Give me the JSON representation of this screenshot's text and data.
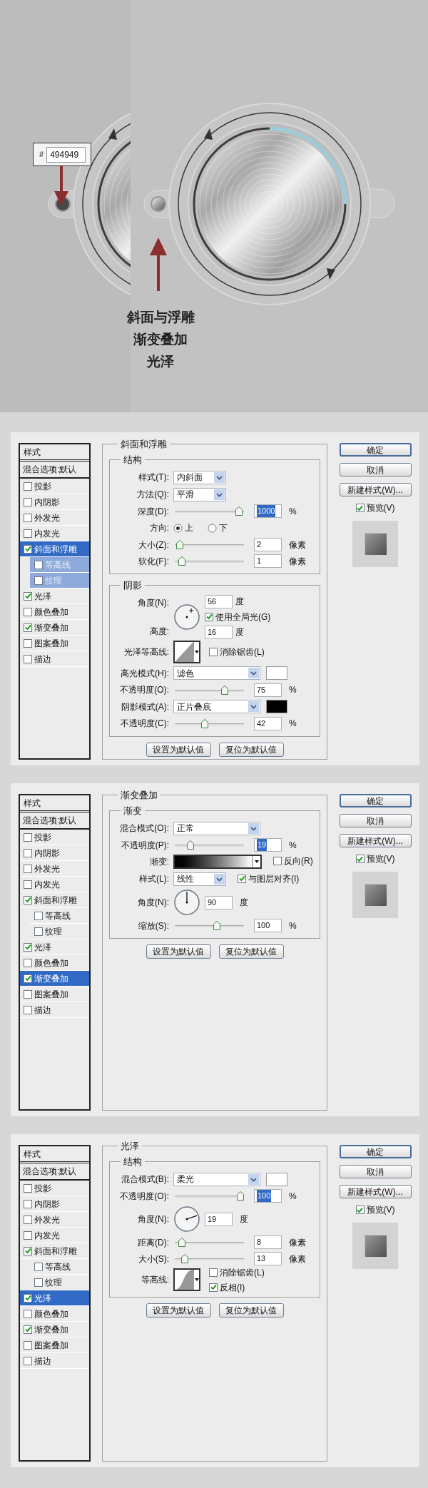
{
  "artwork": {
    "color_label": {
      "hash": "#",
      "value": "494949"
    },
    "captions": [
      "斜面与浮雕",
      "渐变叠加",
      "光泽"
    ]
  },
  "dialogs": [
    {
      "styles_header": "样式",
      "blend_options": "混合选项:默认",
      "styles": [
        {
          "label": "投影",
          "checked": false,
          "selected": false
        },
        {
          "label": "内阴影",
          "checked": false,
          "selected": false
        },
        {
          "label": "外发光",
          "checked": false,
          "selected": false
        },
        {
          "label": "内发光",
          "checked": false,
          "selected": false
        },
        {
          "label": "斜面和浮雕",
          "checked": true,
          "selected": true,
          "children": [
            {
              "label": "等高线",
              "checked": false,
              "selected": false
            },
            {
              "label": "纹理",
              "checked": false,
              "selected": false
            }
          ]
        },
        {
          "label": "光泽",
          "checked": true,
          "selected": false
        },
        {
          "label": "颜色叠加",
          "checked": false,
          "selected": false
        },
        {
          "label": "渐变叠加",
          "checked": true,
          "selected": false
        },
        {
          "label": "图案叠加",
          "checked": false,
          "selected": false
        },
        {
          "label": "描边",
          "checked": false,
          "selected": false
        }
      ],
      "section_title": "斜面和浮雕",
      "groups": [
        {
          "title": "结构",
          "rows": [
            {
              "kind": "select",
              "label": "样式(T):",
              "value": "内斜面"
            },
            {
              "kind": "select",
              "label": "方法(Q):",
              "value": "平滑"
            },
            {
              "kind": "slider",
              "label": "深度(D):",
              "level": 0.98,
              "value": "1000",
              "unit": "%",
              "value_selected": true
            },
            {
              "kind": "radio",
              "label": "方向:",
              "options": [
                {
                  "label": "上",
                  "selected": true
                },
                {
                  "label": "下",
                  "selected": false
                }
              ]
            },
            {
              "kind": "slider",
              "label": "大小(Z):",
              "level": 0.02,
              "value": "2",
              "unit": "像素",
              "value_selected": false
            },
            {
              "kind": "slider",
              "label": "软化(F):",
              "level": 0.06,
              "value": "1",
              "unit": "像素",
              "value_selected": false
            }
          ]
        },
        {
          "title": "阴影",
          "rows": [
            {
              "kind": "angle",
              "label": "角度(N):",
              "value": "56",
              "unit": "度",
              "global_light": {
                "label": "使用全局光(G)",
                "checked": true
              },
              "altitude": {
                "label": "高度:",
                "value": "16",
                "unit": "度"
              }
            },
            {
              "kind": "contour_linear",
              "label": "光泽等高线:",
              "options": [
                {
                  "label": "消除锯齿(L)",
                  "checked": false
                }
              ]
            },
            {
              "kind": "mode_select",
              "label": "高光模式(H):",
              "value": "滤色",
              "color": "#ffffff"
            },
            {
              "kind": "slider",
              "label": "不透明度(O):",
              "level": 0.75,
              "value": "75",
              "unit": "%",
              "value_selected": false
            },
            {
              "kind": "mode_select",
              "label": "阴影模式(A):",
              "value": "正片叠底",
              "color": "#000000"
            },
            {
              "kind": "slider",
              "label": "不透明度(C):",
              "level": 0.42,
              "value": "42",
              "unit": "%",
              "value_selected": false
            }
          ]
        }
      ],
      "default_buttons": [
        "设置为默认值",
        "复位为默认值"
      ],
      "buttons": [
        {
          "label": "确定",
          "default": true
        },
        {
          "label": "取消",
          "default": false
        },
        {
          "label": "新建样式(W)...",
          "default": false
        }
      ],
      "preview": {
        "label": "预览(V)",
        "checked": true
      }
    },
    {
      "styles_header": "样式",
      "blend_options": "混合选项:默认",
      "styles": [
        {
          "label": "投影",
          "checked": false,
          "selected": false
        },
        {
          "label": "内阴影",
          "checked": false,
          "selected": false
        },
        {
          "label": "外发光",
          "checked": false,
          "selected": false
        },
        {
          "label": "内发光",
          "checked": false,
          "selected": false
        },
        {
          "label": "斜面和浮雕",
          "checked": true,
          "selected": false,
          "children": [
            {
              "label": "等高线",
              "checked": false,
              "selected": false
            },
            {
              "label": "纹理",
              "checked": false,
              "selected": false
            }
          ]
        },
        {
          "label": "光泽",
          "checked": true,
          "selected": false
        },
        {
          "label": "颜色叠加",
          "checked": false,
          "selected": false
        },
        {
          "label": "渐变叠加",
          "checked": true,
          "selected": true
        },
        {
          "label": "图案叠加",
          "checked": false,
          "selected": false
        },
        {
          "label": "描边",
          "checked": false,
          "selected": false
        }
      ],
      "section_title": "渐变叠加",
      "groups": [
        {
          "title": "渐变",
          "rows": [
            {
              "kind": "mode_select",
              "label": "混合模式(O):",
              "value": "正常"
            },
            {
              "kind": "slider",
              "label": "不透明度(P):",
              "level": 0.19,
              "value": "19",
              "unit": "%",
              "value_selected": true
            },
            {
              "kind": "gradient",
              "label": "渐变:",
              "options": [
                {
                  "label": "反向(R)",
                  "checked": false
                }
              ]
            },
            {
              "kind": "select",
              "label": "样式(L):",
              "value": "线性",
              "options": [
                {
                  "label": "与图层对齐(I)",
                  "checked": true
                }
              ]
            },
            {
              "kind": "angle",
              "label": "角度(N):",
              "value": "90",
              "unit": "度"
            },
            {
              "kind": "slider",
              "label": "缩放(S):",
              "level": 0.62,
              "value": "100",
              "unit": "%",
              "value_selected": false
            }
          ]
        }
      ],
      "default_buttons": [
        "设置为默认值",
        "复位为默认值"
      ],
      "buttons": [
        {
          "label": "确定",
          "default": true
        },
        {
          "label": "取消",
          "default": false
        },
        {
          "label": "新建样式(W)...",
          "default": false
        }
      ],
      "preview": {
        "label": "预览(V)",
        "checked": true
      }
    },
    {
      "styles_header": "样式",
      "blend_options": "混合选项:默认",
      "styles": [
        {
          "label": "投影",
          "checked": false,
          "selected": false
        },
        {
          "label": "内阴影",
          "checked": false,
          "selected": false
        },
        {
          "label": "外发光",
          "checked": false,
          "selected": false
        },
        {
          "label": "内发光",
          "checked": false,
          "selected": false
        },
        {
          "label": "斜面和浮雕",
          "checked": true,
          "selected": false,
          "children": [
            {
              "label": "等高线",
              "checked": false,
              "selected": false
            },
            {
              "label": "纹理",
              "checked": false,
              "selected": false
            }
          ]
        },
        {
          "label": "光泽",
          "checked": true,
          "selected": true
        },
        {
          "label": "颜色叠加",
          "checked": false,
          "selected": false
        },
        {
          "label": "渐变叠加",
          "checked": true,
          "selected": false
        },
        {
          "label": "图案叠加",
          "checked": false,
          "selected": false
        },
        {
          "label": "描边",
          "checked": false,
          "selected": false
        }
      ],
      "section_title": "光泽",
      "groups": [
        {
          "title": "结构",
          "rows": [
            {
              "kind": "mode_select",
              "label": "混合模式(B):",
              "value": "柔光",
              "color": "#ffffff"
            },
            {
              "kind": "slider",
              "label": "不透明度(O):",
              "level": 1.0,
              "value": "100",
              "unit": "%",
              "value_selected": true
            },
            {
              "kind": "angle",
              "label": "角度(N):",
              "value": "19",
              "unit": "度"
            },
            {
              "kind": "slider",
              "label": "距离(D):",
              "level": 0.06,
              "value": "8",
              "unit": "像素",
              "value_selected": false
            },
            {
              "kind": "slider",
              "label": "大小(S):",
              "level": 0.1,
              "value": "13",
              "unit": "像素",
              "value_selected": false
            },
            {
              "kind": "contour_curve",
              "label": "等高线:",
              "options": [
                {
                  "label": "消除锯齿(L)",
                  "checked": false
                },
                {
                  "label": "反相(I)",
                  "checked": true
                }
              ]
            }
          ]
        }
      ],
      "default_buttons": [
        "设置为默认值",
        "复位为默认值"
      ],
      "buttons": [
        {
          "label": "确定",
          "default": true
        },
        {
          "label": "取消",
          "default": false
        },
        {
          "label": "新建样式(W)...",
          "default": false
        }
      ],
      "preview": {
        "label": "预览(V)",
        "checked": true
      }
    }
  ]
}
